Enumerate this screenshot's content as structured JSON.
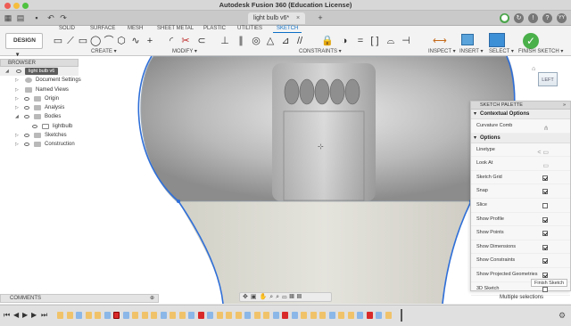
{
  "window": {
    "title": "Autodesk Fusion 360 (Education License)"
  },
  "tabbar": {
    "doc_tab": "light bulb v6*",
    "user_initials": "YY"
  },
  "ribbon": {
    "design_label": "DESIGN",
    "tabs": [
      "SOLID",
      "SURFACE",
      "MESH",
      "SHEET METAL",
      "PLASTIC",
      "UTILITIES",
      "SKETCH"
    ],
    "groups": [
      "CREATE",
      "MODIFY",
      "CONSTRAINTS",
      "INSPECT",
      "INSERT",
      "SELECT",
      "FINISH SKETCH"
    ]
  },
  "browser": {
    "header": "BROWSER",
    "root": "light bulb v6",
    "items": [
      "Document Settings",
      "Named Views",
      "Origin",
      "Analysis",
      "Bodies",
      "lightbulb",
      "Sketches",
      "Construction"
    ]
  },
  "viewcube": {
    "face": "LEFT"
  },
  "palette": {
    "header": "SKETCH PALETTE",
    "contextual_title": "Contextual Options",
    "curvature_comb": "Curvature Comb",
    "options_title": "Options",
    "options": [
      {
        "label": "Linetype",
        "checked": null
      },
      {
        "label": "Look At",
        "checked": null
      },
      {
        "label": "Sketch Grid",
        "checked": true
      },
      {
        "label": "Snap",
        "checked": true
      },
      {
        "label": "Slice",
        "checked": false
      },
      {
        "label": "Show Profile",
        "checked": true
      },
      {
        "label": "Show Points",
        "checked": true
      },
      {
        "label": "Show Dimensions",
        "checked": true
      },
      {
        "label": "Show Constraints",
        "checked": true
      },
      {
        "label": "Show Projected Geometries",
        "checked": true
      },
      {
        "label": "3D Sketch",
        "checked": false
      }
    ],
    "finish_label": "Finish Sketch"
  },
  "status": {
    "comments": "COMMENTS",
    "selection": "Multiple selections"
  },
  "colors": {
    "accent": "#0b6fc8",
    "finish_green": "#4ab04a",
    "sketch_blue": "#2f6fd8",
    "selected_red": "#d92a2a"
  }
}
